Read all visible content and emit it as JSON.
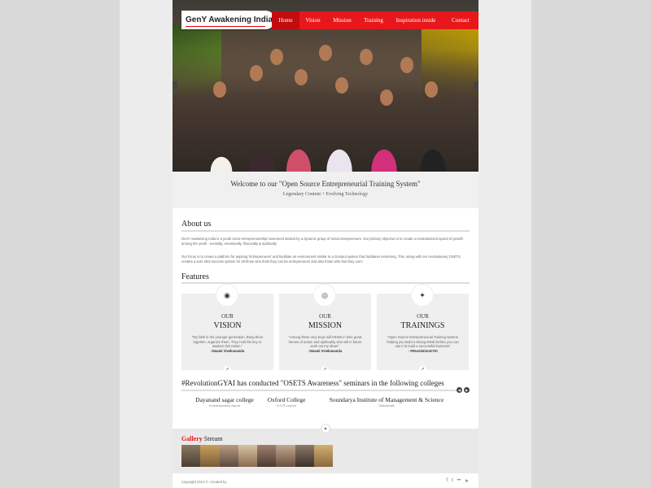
{
  "brand": {
    "logo_text": "GenY Awakening India",
    "logo_mark": "™"
  },
  "nav": {
    "items": [
      "Home",
      "Vision",
      "Mission",
      "Training",
      "Inspiration inside",
      "Contact"
    ]
  },
  "welcome": {
    "title": "Welcome to our \"Open Source Entrepreneurial Training System\"",
    "subtitle": "Legendary Content + Evolving Technology"
  },
  "about": {
    "title": "About us",
    "para1": "GenY Awakening India is a youth socio-entrepreneurship movement started by a dynamic group of serial entrepreneurs. Our primary objective is to create a revolutionized speed of growth among the youth - mentally, emotionally, financially & spiritually.",
    "para2": "Our focus is to create a platform for aspiring 'Entrepreneurs' and facilitate an environment similar to a Gurukul system that facilitates mentoring. This, along with our revolutionary OSETS, creates a sure shot success system for all those who think they can be entrepreneurs and also those who feel they can't."
  },
  "features": {
    "title": "Features",
    "cards": [
      {
        "icon": "eye-icon",
        "symbol": "◉",
        "our": "OUR",
        "heading": "VISION",
        "quote": "\"My faith in the younger generation. Bring them together, organize them. They hold the key to awaken this nation.\"",
        "author": "-Swami Vivekananda"
      },
      {
        "icon": "target-icon",
        "symbol": "◎",
        "our": "OUR",
        "heading": "MISSION",
        "quote": "\"Among these very boys will ARISE in time great heroes of action and spirituality who will in future work out my ideas\".",
        "author": "-Swami Vivekananda"
      },
      {
        "icon": "lightbulb-icon",
        "symbol": "✦",
        "our": "OUR",
        "heading": "TRAININGS",
        "quote": "\"Open Source Entrepreneurial Training System helping you build a strong MIND before you can use it to build a successful business\"",
        "author": "- #RevolutionGYAI"
      }
    ]
  },
  "seminars": {
    "title": "#RevolutionGYAI has conducted \"OSETS Awareness\" seminars in the following colleges",
    "colleges": [
      {
        "name": "Dayanand sagar college",
        "location": "Kumaraswamy layout"
      },
      {
        "name": "Oxford College",
        "location": "H.S.R Layout"
      },
      {
        "name": "Soundarya Institute of Management & Science",
        "location": "Sidedahalli"
      }
    ]
  },
  "gallery": {
    "title_red": "Gallery",
    "title_rest": " Stream"
  },
  "footer": {
    "copyright": "Copyright 2013 ©. Created by"
  }
}
